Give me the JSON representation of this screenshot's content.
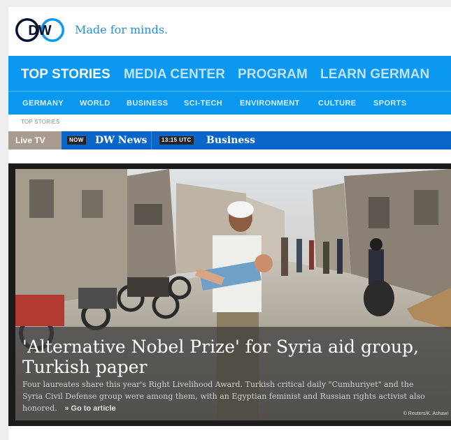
{
  "header": {
    "logo_text": "DW",
    "tagline": "Made for minds."
  },
  "main_nav": [
    {
      "label": "TOP STORIES",
      "active": true
    },
    {
      "label": "MEDIA CENTER",
      "active": false
    },
    {
      "label": "PROGRAM",
      "active": false
    },
    {
      "label": "LEARN GERMAN",
      "active": false
    }
  ],
  "sub_nav": [
    "GERMANY",
    "WORLD",
    "BUSINESS",
    "SCI-TECH",
    "ENVIRONMENT",
    "CULTURE",
    "SPORTS"
  ],
  "breadcrumb": "TOP STORIES",
  "live_bar": {
    "live_tv": "Live TV",
    "now_badge": "NOW",
    "now_channel": "DW News",
    "next_badge": "13:15 UTC",
    "next_channel": "Business"
  },
  "hero": {
    "headline": "'Alternative Nobel Prize' for Syria aid group, Turkish paper",
    "teaser": "Four laureates share this year's Right Livelihood Award. Turkish critical daily \"Cumhuriyet\" and the Syria Civil Defense group were among them, with an Egyptian feminist and Russian rights activist also honored.",
    "go_to_article": "» Go to article",
    "credit": "© Reuters/K. Ashawi"
  },
  "colors": {
    "brand_blue": "#0a98f0",
    "live_bar_blue": "#0a65c9",
    "live_tv_bg": "#a89b8f",
    "tagline_blue": "#2a8fd7"
  }
}
